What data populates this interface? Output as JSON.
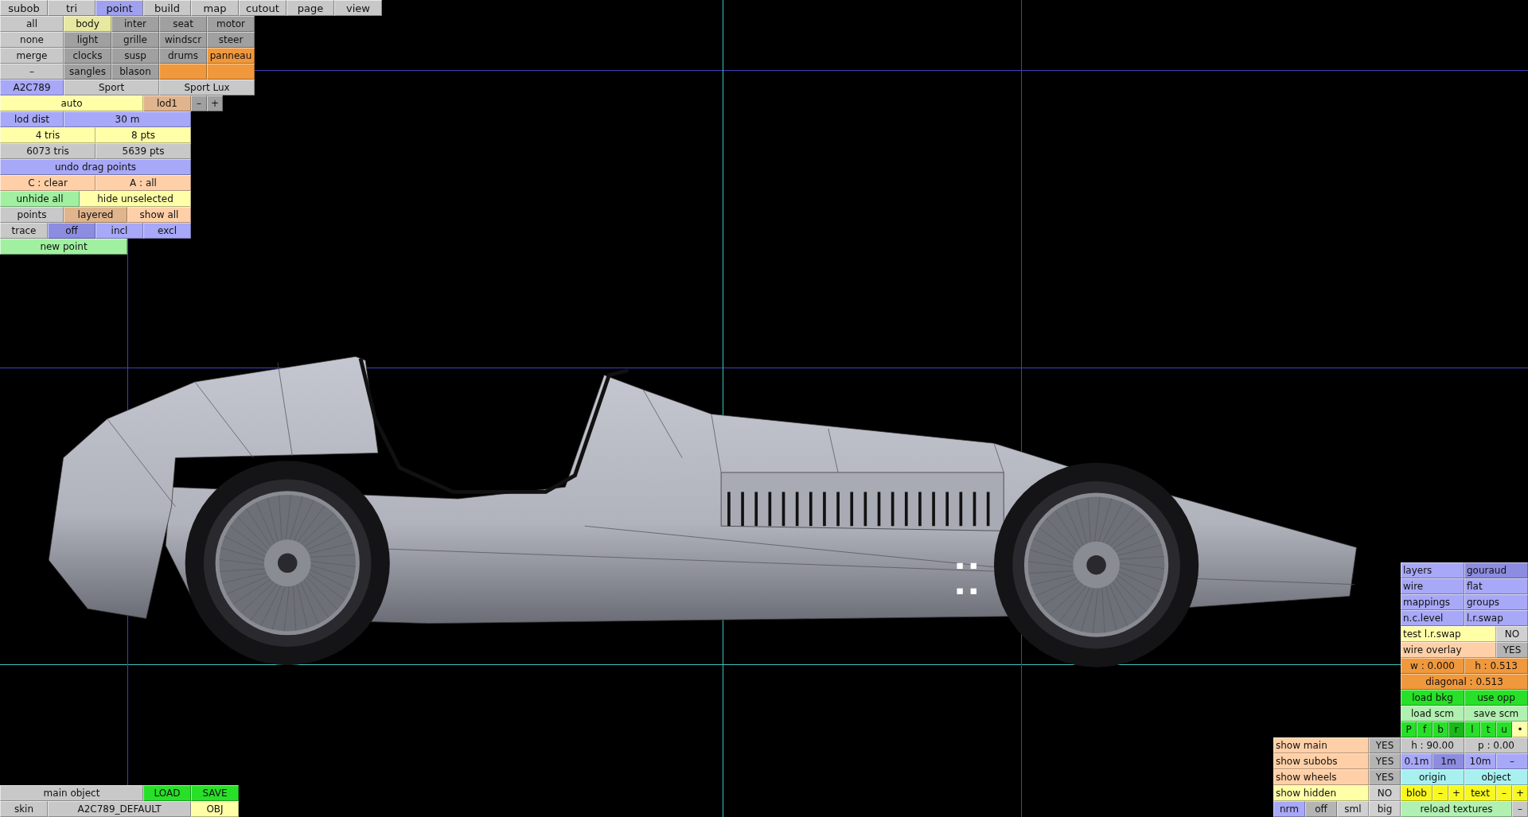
{
  "top_tabs": [
    {
      "label": "subob",
      "selected": false
    },
    {
      "label": "tri",
      "selected": false
    },
    {
      "label": "point",
      "selected": true
    },
    {
      "label": "build",
      "selected": false
    },
    {
      "label": "map",
      "selected": false
    },
    {
      "label": "cutout",
      "selected": false
    },
    {
      "label": "page",
      "selected": false
    },
    {
      "label": "view",
      "selected": false
    }
  ],
  "panels": [
    {
      "rows": [
        [
          {
            "label": "all",
            "color": "#c8c8c8"
          },
          {
            "label": "body",
            "color": "#e8e8a0"
          },
          {
            "label": "inter",
            "color": "#a0a0a0"
          },
          {
            "label": "seat",
            "color": "#a0a0a0"
          },
          {
            "label": "motor",
            "color": "#a0a0a0"
          }
        ],
        [
          {
            "label": "none",
            "color": "#c8c8c8"
          },
          {
            "label": "light",
            "color": "#a0a0a0"
          },
          {
            "label": "grille",
            "color": "#a0a0a0"
          },
          {
            "label": "windscr",
            "color": "#a0a0a0"
          },
          {
            "label": "steer",
            "color": "#a0a0a0"
          }
        ],
        [
          {
            "label": "merge",
            "color": "#c8c8c8"
          },
          {
            "label": "clocks",
            "color": "#a0a0a0"
          },
          {
            "label": "susp",
            "color": "#a0a0a0"
          },
          {
            "label": "drums",
            "color": "#a0a0a0"
          },
          {
            "label": "panneau",
            "color": "#f0983c"
          }
        ],
        [
          {
            "label": "–",
            "color": "#c8c8c8"
          },
          {
            "label": "sangles",
            "color": "#a0a0a0"
          },
          {
            "label": "blason",
            "color": "#a0a0a0"
          },
          {
            "color": "#f0983c"
          },
          {
            "color": "#f0983c"
          }
        ],
        [
          {
            "label": "A2C789",
            "color": "#a8a8f8"
          },
          {
            "label": "Sport",
            "color": "#c8c8c8"
          },
          {
            "label": "Sport Lux",
            "color": "#c8c8c8"
          }
        ],
        [
          {
            "label": "auto",
            "color": "#ffffa8"
          },
          {
            "label": "lod1",
            "color": "#e0b48c"
          },
          {
            "label": "–",
            "color": "#a0a0a0"
          },
          {
            "label": "+",
            "color": "#a0a0a0"
          }
        ],
        [
          {
            "label": "lod dist",
            "color": "#a8a8f8"
          },
          {
            "label": "30 m",
            "color": "#a8a8f8"
          }
        ],
        [
          {
            "label": "4 tris",
            "color": "#ffffa8"
          },
          {
            "label": "8 pts",
            "color": "#ffffa8"
          }
        ],
        [
          {
            "label": "6073 tris",
            "color": "#c8c8c8"
          },
          {
            "label": "5639 pts",
            "color": "#c8c8c8"
          }
        ],
        [
          {
            "label": "undo drag points",
            "color": "#a8a8f8"
          }
        ],
        [
          {
            "label": "C : clear",
            "color": "#ffd0a8"
          },
          {
            "label": "A : all",
            "color": "#ffd0a8"
          }
        ],
        [
          {
            "label": "unhide all",
            "color": "#a0f0a0"
          },
          {
            "label": "hide unselected",
            "color": "#ffffa8"
          }
        ],
        [
          {
            "label": "points",
            "color": "#c8c8c8"
          },
          {
            "label": "layered",
            "color": "#e0b48c"
          },
          {
            "label": "show all",
            "color": "#ffd0a8"
          }
        ],
        [
          {
            "label": "trace",
            "color": "#c8c8c8"
          },
          {
            "label": "off",
            "color": "#8c8ce0"
          },
          {
            "label": "incl",
            "color": "#a8a8f8"
          },
          {
            "label": "excl",
            "color": "#a8a8f8"
          }
        ],
        [
          {
            "label": "new point",
            "color": "#a0f0a0"
          }
        ]
      ]
    },
    {
      "rows": [
        [
          {
            "label": "main object",
            "color": "#c8c8c8"
          },
          {
            "label": "LOAD",
            "color": "#28e028"
          },
          {
            "label": "SAVE",
            "color": "#28e028"
          }
        ],
        [
          {
            "label": "skin",
            "color": "#c8c8c8"
          },
          {
            "label": "A2C789_DEFAULT",
            "color": "#c8c8c8"
          },
          {
            "label": "OBJ",
            "color": "#ffffa8"
          }
        ]
      ]
    },
    {
      "rows": [
        [
          {
            "label": "show main",
            "color": "#ffd0a8"
          },
          {
            "label": "YES",
            "color": "#b4b4b4"
          }
        ],
        [
          {
            "label": "show subobs",
            "color": "#ffd0a8"
          },
          {
            "label": "YES",
            "color": "#b4b4b4"
          }
        ],
        [
          {
            "label": "show wheels",
            "color": "#ffd0a8"
          },
          {
            "label": "YES",
            "color": "#b4b4b4"
          }
        ],
        [
          {
            "label": "show hidden",
            "color": "#ffffa8"
          },
          {
            "label": "NO",
            "color": "#d0d0d0"
          }
        ]
      ]
    },
    {
      "rows": [
        [
          {
            "label": "nrm",
            "color": "#a8a8f8"
          },
          {
            "label": "off",
            "color": "#b4b4b4"
          },
          {
            "label": "sml",
            "color": "#d0d0d0"
          },
          {
            "label": "big",
            "color": "#d0d0d0"
          }
        ]
      ]
    },
    {
      "rows": [
        [
          {
            "label": "layers",
            "color": "#a8a8f8"
          },
          {
            "label": "gouraud",
            "color": "#8c8ce0"
          }
        ],
        [
          {
            "label": "wire",
            "color": "#a8a8f8"
          },
          {
            "label": "flat",
            "color": "#a8a8f8"
          }
        ],
        [
          {
            "label": "mappings",
            "color": "#a8a8f8"
          },
          {
            "label": "groups",
            "color": "#a8a8f8"
          }
        ],
        [
          {
            "label": "n.c.level",
            "color": "#a8a8f8"
          },
          {
            "label": "l.r.swap",
            "color": "#a8a8f8"
          }
        ],
        [
          {
            "label": "test l.r.swap",
            "color": "#ffffa8"
          },
          {
            "label": "NO",
            "color": "#d0d0d0"
          }
        ],
        [
          {
            "label": "wire overlay",
            "color": "#ffd0a8"
          },
          {
            "label": "YES",
            "color": "#b4b4b4"
          }
        ],
        [
          {
            "label": "w : 0.000",
            "color": "#f0983c"
          },
          {
            "label": "h : 0.513",
            "color": "#f0983c"
          }
        ],
        [
          {
            "label": "diagonal : 0.513",
            "color": "#f0983c"
          }
        ],
        [
          {
            "label": "load bkg",
            "color": "#28e028"
          },
          {
            "label": "use opp",
            "color": "#28e028"
          }
        ],
        [
          {
            "label": "load scm",
            "color": "#b0f0b0"
          },
          {
            "label": "save scm",
            "color": "#b0f0b0"
          }
        ]
      ]
    },
    {
      "rows": [
        [
          {
            "label": "P",
            "color": "#28e028"
          },
          {
            "label": "f",
            "color": "#28e028"
          },
          {
            "label": "b",
            "color": "#28e028"
          },
          {
            "label": "r",
            "color": "#18b818"
          },
          {
            "label": "l",
            "color": "#28e028"
          },
          {
            "label": "t",
            "color": "#28e028"
          },
          {
            "label": "u",
            "color": "#28e028"
          },
          {
            "label": "•",
            "color": "#ffffa8"
          }
        ]
      ]
    },
    {
      "rows": [
        [
          {
            "label": "h : 90.00",
            "color": "#c8c8c8"
          },
          {
            "label": "p : 0.00",
            "color": "#c8c8c8"
          }
        ]
      ]
    },
    {
      "rows": [
        [
          {
            "label": "0.1m",
            "color": "#a8a8f8"
          },
          {
            "label": "1m",
            "color": "#8c8ce0"
          },
          {
            "label": "10m",
            "color": "#a8a8f8"
          },
          {
            "label": "–",
            "color": "#a8a8f8"
          }
        ]
      ]
    },
    {
      "rows": [
        [
          {
            "label": "origin",
            "color": "#a8f0f0"
          },
          {
            "label": "object",
            "color": "#a8f0f0"
          }
        ]
      ]
    },
    {
      "rows": [
        [
          {
            "label": "blob",
            "color": "#f8f820"
          },
          {
            "label": "–",
            "color": "#f8f820"
          },
          {
            "label": "+",
            "color": "#f8f820"
          },
          {
            "label": "text",
            "color": "#f8f820"
          },
          {
            "label": "–",
            "color": "#f8f820"
          },
          {
            "label": "+",
            "color": "#f8f820"
          }
        ]
      ]
    },
    {
      "rows": [
        [
          {
            "label": "reload textures",
            "color": "#b0f0b0"
          },
          {
            "label": "–",
            "color": "#c8c8c8"
          }
        ]
      ]
    }
  ]
}
